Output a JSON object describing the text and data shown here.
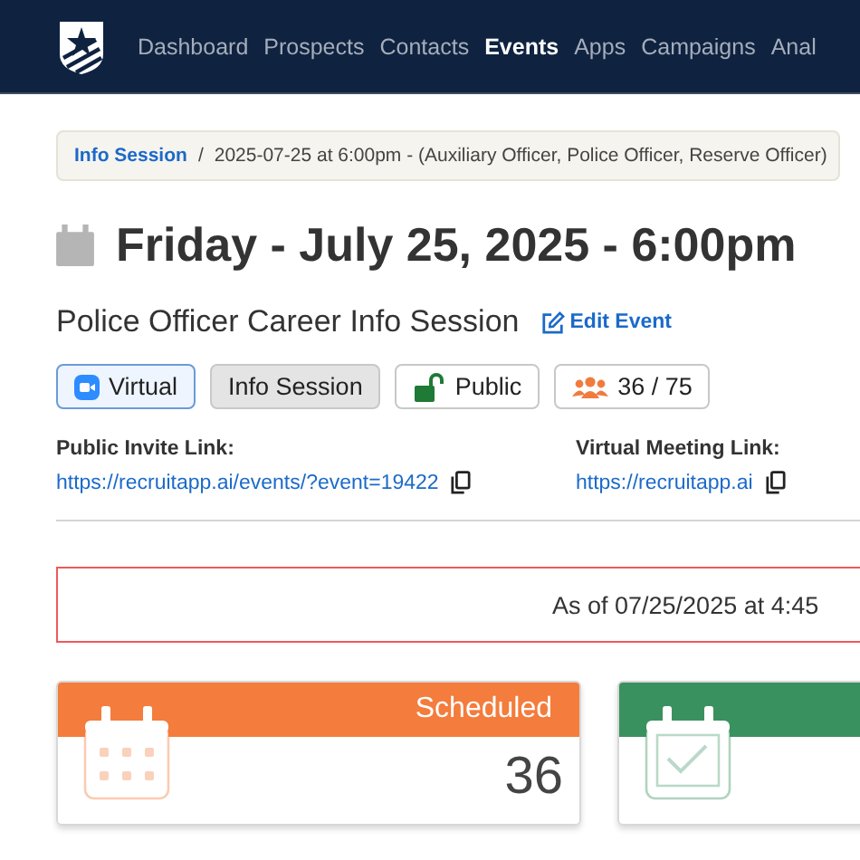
{
  "nav": {
    "items": [
      {
        "label": "Dashboard",
        "selected": false
      },
      {
        "label": "Prospects",
        "selected": false
      },
      {
        "label": "Contacts",
        "selected": false
      },
      {
        "label": "Events",
        "selected": true
      },
      {
        "label": "Apps",
        "selected": false
      },
      {
        "label": "Campaigns",
        "selected": false
      },
      {
        "label": "Anal",
        "selected": false
      }
    ]
  },
  "breadcrumb": {
    "link": "Info Session",
    "separator": "/",
    "current": "2025-07-25 at 6:00pm - (Auxiliary Officer, Police Officer, Reserve Officer)"
  },
  "heading": "Friday - July 25, 2025 - 6:00pm",
  "event_title": "Police Officer Career Info Session",
  "edit_link": "Edit Event",
  "badges": [
    {
      "kind": "virtual",
      "label": "Virtual"
    },
    {
      "kind": "type",
      "label": "Info Session"
    },
    {
      "kind": "access",
      "label": "Public"
    },
    {
      "kind": "capacity",
      "label": "36 / 75"
    }
  ],
  "links": [
    {
      "label": "Public Invite Link:",
      "url": "https://recruitapp.ai/events/?event=19422"
    },
    {
      "label": "Virtual Meeting Link:",
      "url": "https://recruitapp.ai"
    }
  ],
  "alert": {
    "text": "As of 07/25/2025 at 4:45"
  },
  "cards": [
    {
      "kind": "scheduled",
      "color": "#f47c3c",
      "label": "Scheduled",
      "value": "36"
    },
    {
      "kind": "attended",
      "color": "#3a9160"
    }
  ]
}
